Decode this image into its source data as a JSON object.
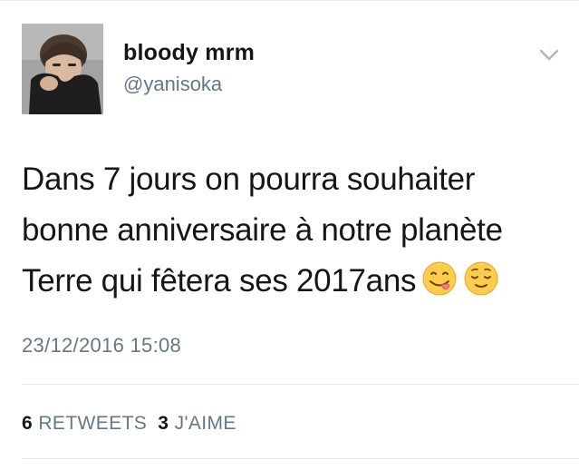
{
  "tweet": {
    "author": {
      "display_name": "bloody mrm",
      "handle": "@yanisoka"
    },
    "text_lines": [
      "Dans 7 jours on pourra souhaiter",
      "bonne anniversaire à notre planète",
      "Terre qui fêtera ses 2017ans"
    ],
    "emojis": [
      "face-savoring-food-emoji",
      "relieved-face-emoji"
    ],
    "timestamp": "23/12/2016 15:08",
    "stats": {
      "retweets_count": "6",
      "retweets_label": "RETWEETS",
      "likes_count": "3",
      "likes_label": "J'AIME"
    }
  },
  "icons": {
    "menu": "chevron-down-icon"
  },
  "colors": {
    "text": "#14171a",
    "secondary": "#657786",
    "divider": "#e1e8ed",
    "emoji_yellow": "#ffcc4d"
  }
}
